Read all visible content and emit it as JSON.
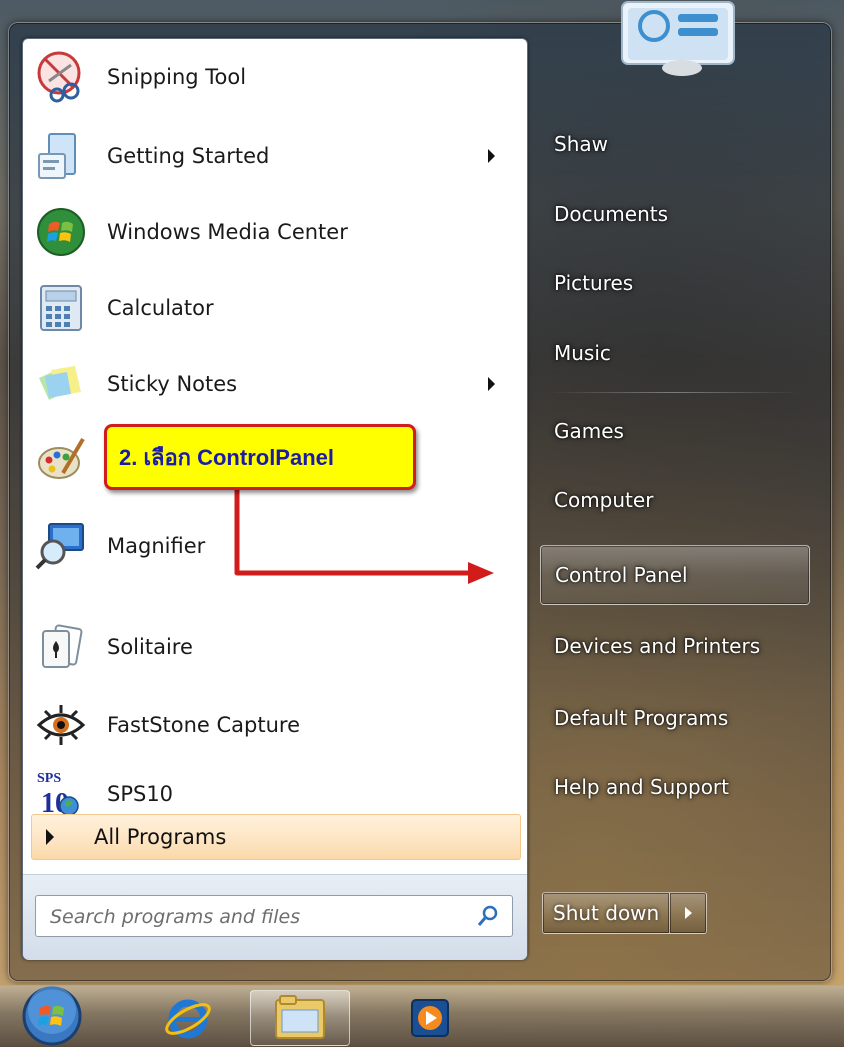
{
  "programs": [
    {
      "label": "Snipping Tool",
      "icon": "scissors-icon",
      "submenu": false
    },
    {
      "label": "Getting Started",
      "icon": "getting-started-icon",
      "submenu": true
    },
    {
      "label": "Windows Media Center",
      "icon": "media-center-icon",
      "submenu": false
    },
    {
      "label": "Calculator",
      "icon": "calculator-icon",
      "submenu": false
    },
    {
      "label": "Sticky Notes",
      "icon": "sticky-notes-icon",
      "submenu": true
    },
    {
      "label": "",
      "icon": "paint-palette-icon",
      "submenu": false
    },
    {
      "label": "Magnifier",
      "icon": "magnifier-icon",
      "submenu": false
    },
    {
      "label": "Solitaire",
      "icon": "solitaire-icon",
      "submenu": false
    },
    {
      "label": "FastStone Capture",
      "icon": "faststone-eye-icon",
      "submenu": false
    },
    {
      "label": "SPS10",
      "icon": "sps-icon",
      "submenu": false
    }
  ],
  "all_programs": {
    "label": "All Programs"
  },
  "search": {
    "placeholder": "Search programs and files"
  },
  "right_pane": {
    "items": [
      {
        "label": "Shaw"
      },
      {
        "label": "Documents"
      },
      {
        "label": "Pictures"
      },
      {
        "label": "Music"
      },
      {
        "label": "Games"
      },
      {
        "label": "Computer"
      },
      {
        "label": "Control Panel",
        "highlighted": true
      },
      {
        "label": "Devices and Printers"
      },
      {
        "label": "Default Programs"
      },
      {
        "label": "Help and Support"
      }
    ],
    "shutdown_label": "Shut down"
  },
  "annotation": {
    "text": "2. เลือก ControlPanel",
    "colors": {
      "fill": "#ffff00",
      "border": "#d21c1c",
      "text": "#1b1ba6"
    }
  },
  "taskbar": {
    "items": [
      {
        "icon": "start-orb-icon"
      },
      {
        "icon": "internet-explorer-icon"
      },
      {
        "icon": "windows-explorer-icon",
        "active": true
      },
      {
        "icon": "media-player-icon"
      }
    ]
  },
  "theme": {
    "highlight": "#fde4c2",
    "pane_bg": "#ffffff"
  }
}
